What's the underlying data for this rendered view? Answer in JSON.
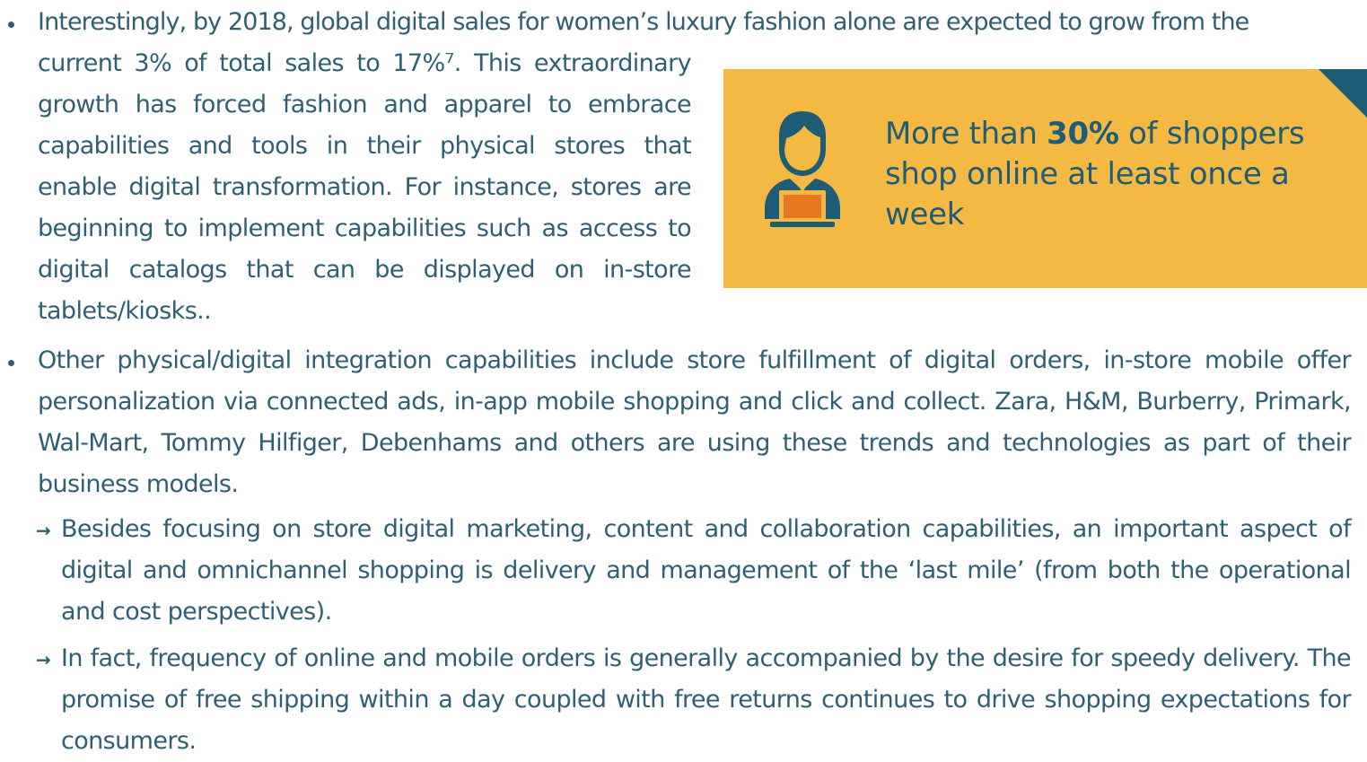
{
  "paragraph1": {
    "line1": "Interestingly, by 2018, global digital sales for women’s luxury fashion alone are expected to grow from the",
    "wrapped_text": "current 3% of total sales to 17%⁷. This extraordinary growth has forced fashion and apparel to embrace capabilities and tools in their physical stores that enable digital transformation. For instance, stores are beginning to implement capabilities such as access to digital catalogs that can be displayed on in-store tablets/kiosks.."
  },
  "callout": {
    "prefix": "More than ",
    "highlight": "30%",
    "suffix": " of shoppers shop online at least once a week",
    "icon": "person-with-laptop-icon",
    "colors": {
      "background": "#f4b942",
      "text": "#1f5c75",
      "corner": "#1f5c75",
      "laptop": "#e87722"
    }
  },
  "paragraph2": {
    "text": "Other physical/digital integration capabilities include store fulfillment of digital orders, in-store mobile offer personalization via connected ads, in-app mobile shopping and click and collect. Zara, H&M, Burberry, Primark, Wal-Mart, Tommy Hilfiger, Debenhams and others are using these trends and technologies as part of their business models."
  },
  "subbullets": [
    {
      "text": "Besides focusing on store digital marketing, content and collaboration capabilities, an important aspect of digital and omnichannel shopping is delivery and management of the ‘last mile’ (from both the operational and cost perspectives)."
    },
    {
      "text": "In fact, frequency of online and mobile orders is generally accompanied by the desire for speedy delivery. The promise of free shipping within a day coupled with free returns continues to drive shopping expectations for consumers."
    }
  ],
  "bullet_marker": "•",
  "subbullet_marker": "→"
}
